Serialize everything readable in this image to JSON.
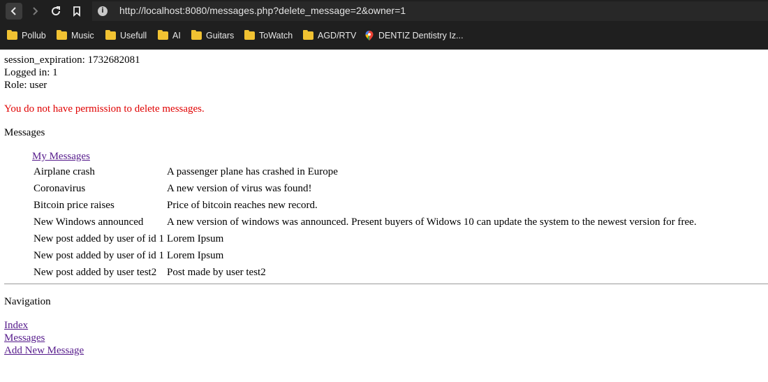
{
  "browser": {
    "url": "http://localhost:8080/messages.php?delete_message=2&owner=1",
    "bookmarks": [
      "Pollub",
      "Music",
      "Usefull",
      "AI",
      "Guitars",
      "ToWatch",
      "AGD/RTV",
      "DENTIZ Dentistry Iz..."
    ]
  },
  "session": {
    "expiration": "session_expiration: 1732682081",
    "logged_in": "Logged in: 1",
    "role": "Role: user"
  },
  "error_message": "You do not have permission to delete messages.",
  "messages_heading": "Messages",
  "messages_table": {
    "caption_link": "My Messages",
    "rows": [
      {
        "title": "Airplane crash",
        "content": "A passenger plane has crashed in Europe"
      },
      {
        "title": "Coronavirus",
        "content": "A new version of virus was found!"
      },
      {
        "title": "Bitcoin price raises",
        "content": "Price of bitcoin reaches new record."
      },
      {
        "title": "New Windows announced",
        "content": "A new version of windows was announced. Present buyers of Widows 10 can update the system to the newest version for free."
      },
      {
        "title": "New post added by user of id 1",
        "content": "Lorem Ipsum"
      },
      {
        "title": "New post added by user of id 1",
        "content": "Lorem Ipsum"
      },
      {
        "title": "New post added by user test2",
        "content": "Post made by user test2"
      }
    ]
  },
  "navigation": {
    "heading": "Navigation",
    "links": [
      "Index",
      "Messages",
      "Add New Message"
    ]
  }
}
